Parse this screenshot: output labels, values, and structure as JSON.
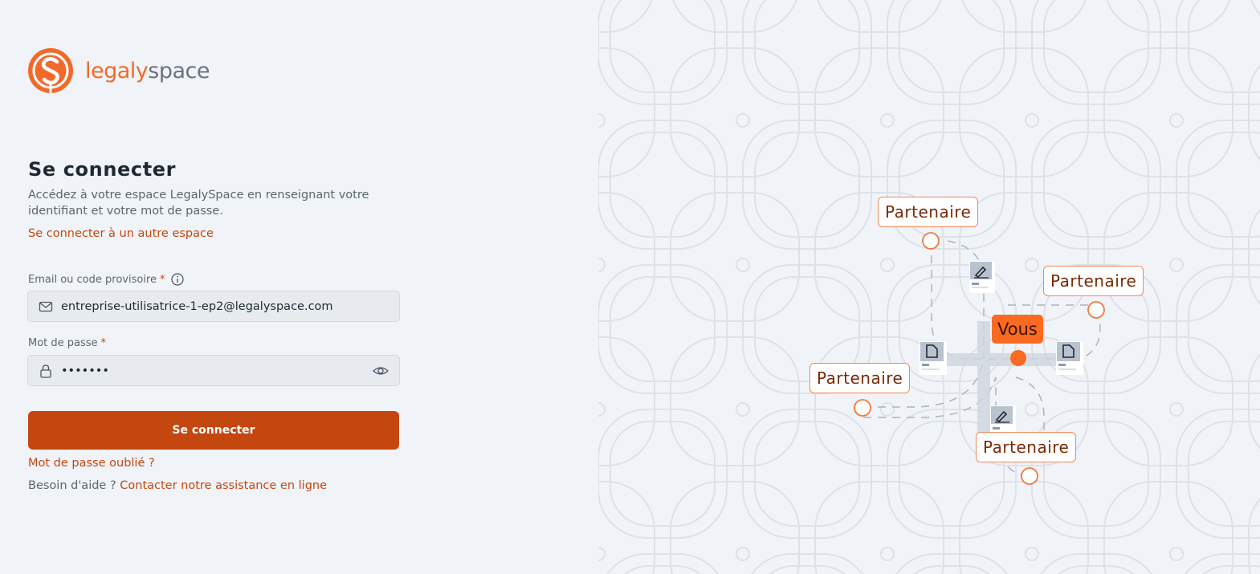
{
  "brand": {
    "name_part1": "legaly",
    "name_part2": "space",
    "primary_color": "#c4470f",
    "logo_color": "#f26a2a"
  },
  "login": {
    "title": "Se connecter",
    "description": "Accédez à votre espace LegalySpace en renseignant votre identifiant et votre mot de passe.",
    "other_space_link": "Se connecter à un autre espace",
    "email_label": "Email ou code provisoire",
    "email_value": "entreprise-utilisatrice-1-ep2@legalyspace.com",
    "password_label": "Mot de passe",
    "password_value": "•••••••",
    "required_mark": "*",
    "submit_label": "Se connecter",
    "forgot_link": "Mot de passe oublié ?",
    "help_text": "Besoin d'aide ?",
    "help_link": "Contacter notre assistance en ligne"
  },
  "illustration": {
    "center_label": "Vous",
    "partner_labels": [
      "Partenaire",
      "Partenaire",
      "Partenaire",
      "Partenaire"
    ],
    "icons": [
      "file-icon",
      "file-icon",
      "signature-icon",
      "signature-icon"
    ]
  }
}
